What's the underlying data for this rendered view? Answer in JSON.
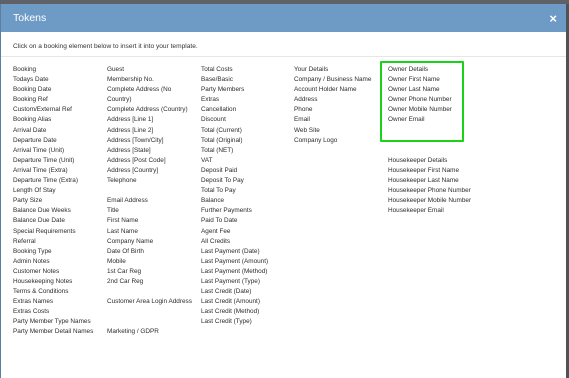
{
  "dialog": {
    "title": "Tokens",
    "close_label": "×",
    "instruction": "Click on a booking element below to insert it into your template."
  },
  "columns": [
    {
      "name": "booking",
      "items": [
        "Booking",
        "Todays Date",
        "Booking Date",
        "Booking Ref",
        "Custom/External Ref",
        "Booking Alias",
        "Arrival Date",
        "Departure Date",
        "Arrival Time (Unit)",
        "Departure Time (Unit)",
        "Arrival Time (Extra)",
        "Departure Time (Extra)",
        "Length Of Stay",
        "Party Size",
        "Balance Due Weeks",
        "Balance Due Date",
        "Special Requirements",
        "Referral",
        "Booking Type",
        "Admin Notes",
        "Customer Notes",
        "Housekeeping Notes",
        "Terms & Conditions",
        "Extras Names",
        "Extras Costs",
        "Party Member Type Names",
        "Party Member Detail Names"
      ]
    },
    {
      "name": "guest",
      "items": [
        "Guest",
        "Membership No.",
        "Complete Address (No",
        "Country)",
        "Complete Address (Country)",
        "Address [Line 1]",
        "Address [Line 2]",
        "Address [Town/City]",
        "Address [State]",
        "Address [Post Code]",
        "Address [Country]",
        "Telephone",
        "",
        "Email Address",
        "Title",
        "First Name",
        "Last Name",
        "Company Name",
        "Date Of Birth",
        "Mobile",
        "1st Car Reg",
        "2nd Car Reg",
        "",
        "Customer Area Login Address",
        "",
        "",
        "Marketing / GDPR"
      ]
    },
    {
      "name": "costs",
      "items": [
        "Total Costs",
        "Base/Basic",
        "Party Members",
        "Extras",
        "Cancellation",
        "Discount",
        "Total (Current)",
        "Total (Original)",
        "Total (NET)",
        "VAT",
        "Deposit Paid",
        "Deposit To Pay",
        "Total To Pay",
        "Balance",
        "Further Payments",
        "Paid To Date",
        "Agent Fee",
        "All Credits",
        "Last Payment (Date)",
        "Last Payment (Amount)",
        "Last Payment (Method)",
        "Last Payment (Type)",
        "Last Credit (Date)",
        "Last Credit (Amount)",
        "Last Credit (Method)",
        "Last Credit (Type)"
      ]
    },
    {
      "name": "your-details",
      "items": [
        "Your Details",
        "Company / Business Name",
        "Account Holder Name",
        "Address",
        "Phone",
        "Email",
        "Web Site",
        "Company Logo"
      ]
    },
    {
      "name": "owner-housekeeper",
      "items": [
        "Owner Details",
        "Owner First Name",
        "Owner Last Name",
        "Owner Phone Number",
        "Owner Mobile Number",
        "Owner Email",
        "",
        "",
        "",
        "Housekeeper Details",
        "Housekeeper First Name",
        "Housekeeper Last Name",
        "Housekeeper Phone Number",
        "Housekeeper Mobile Number",
        "Housekeeper Email"
      ]
    }
  ],
  "colors": {
    "header": "#6e9bc6",
    "highlight": "#18d318",
    "backdrop": "#6b6f73"
  }
}
